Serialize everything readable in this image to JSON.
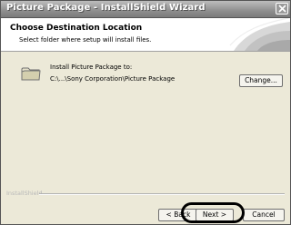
{
  "window": {
    "title": "Picture Package - InstallShield Wizard"
  },
  "header": {
    "title": "Choose Destination Location",
    "subtitle": "Select folder where setup will install files."
  },
  "destination": {
    "label": "Install Picture Package to:",
    "path": "C:\\...\\Sony Corporation\\Picture Package",
    "change_button": "Change..."
  },
  "footer": {
    "brand": "InstallShield",
    "back_button": "< Back",
    "next_button": "Next >",
    "cancel_button": "Cancel"
  },
  "icons": {
    "close": "close-icon",
    "folder": "folder-icon"
  },
  "colors": {
    "titlebar": "#8f8f8f",
    "dialog_bg": "#ece9d8",
    "header_bg": "#ffffff"
  }
}
